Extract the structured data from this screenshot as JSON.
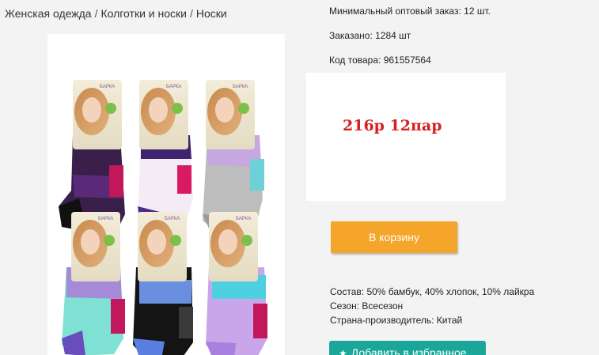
{
  "breadcrumb": {
    "items": [
      "Женская одежда",
      "Колготки и носки",
      "Носки"
    ],
    "separator": "/"
  },
  "product": {
    "image_alt": "Носки детские, 6 пар в упаковках",
    "min_order": "Минимальный оптовый заказ: 12 шт.",
    "ordered": "Заказано: 1284 шт",
    "sku": "Код товара: 961557564",
    "price_note": "216р 12пар",
    "cart_button": "В корзину",
    "specs": [
      {
        "label": "Состав:",
        "value": "50% бамбук, 40% хлопок, 10% лайкра"
      },
      {
        "label": "Сезон:",
        "value": "Всесезон"
      },
      {
        "label": "Страна-производитель:",
        "value": "Китай"
      }
    ],
    "favorite_button": "Добавить в избранное",
    "sock_brand": "БАРКА"
  },
  "colors": {
    "accent_orange": "#f4a52a",
    "accent_teal": "#1aa79a",
    "price_red": "#d62020"
  }
}
